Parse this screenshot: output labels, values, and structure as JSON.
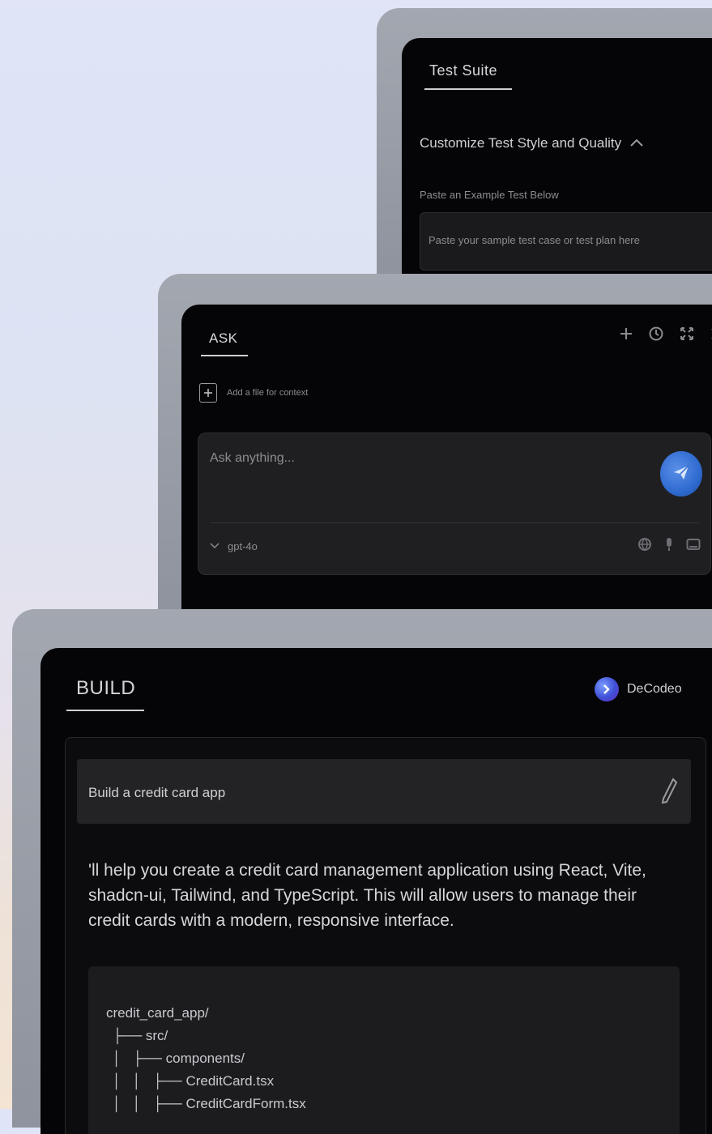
{
  "test_suite": {
    "tab_label": "Test Suite",
    "customize_label": "Customize Test Style and Quality",
    "paste_label": "Paste an Example Test Below",
    "input_placeholder": "Paste your sample test case or test plan here"
  },
  "ask": {
    "tab_label": "ASK",
    "add_file_label": "Add a file for context",
    "input_placeholder": "Ask anything...",
    "model_label": "gpt-4o"
  },
  "build": {
    "tab_label": "BUILD",
    "brand_name": "DeCodeo",
    "prompt_text": "Build a credit card app",
    "response_text": "'ll help you create a credit card management application using React, Vite, shadcn-ui, Tailwind, and TypeScript. This will allow users to manage their credit cards with a modern, responsive interface.",
    "tree": [
      "credit_card_app/",
      "├── src/",
      "│   ├── components/",
      "│   │   ├── CreditCard.tsx",
      "│   │   ├── CreditCardForm.tsx"
    ]
  },
  "colors": {
    "accent_blue": "#2f6bd0",
    "panel_bg": "#050507",
    "frame_gray": "#9a9ea7"
  }
}
